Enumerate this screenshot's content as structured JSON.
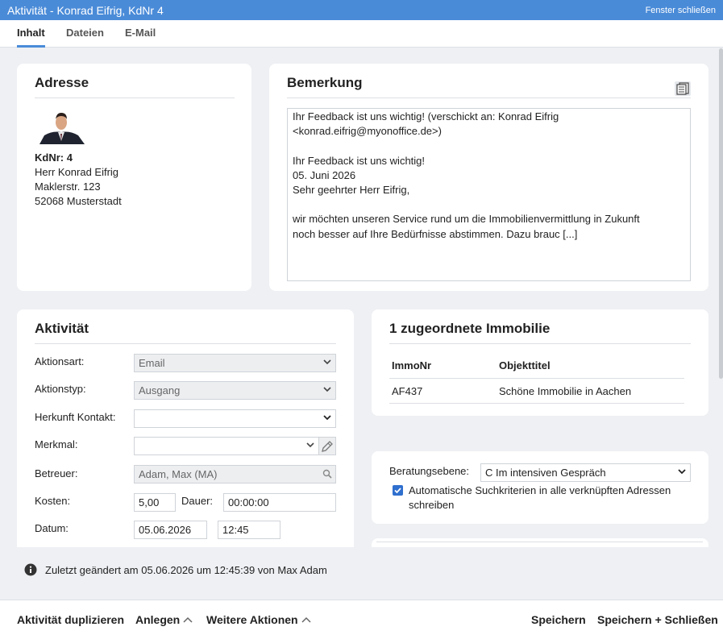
{
  "window": {
    "title": "Aktivität - Konrad Eifrig, KdNr 4",
    "close_label": "Fenster schließen"
  },
  "tabs": [
    {
      "label": "Inhalt"
    },
    {
      "label": "Dateien"
    },
    {
      "label": "E-Mail"
    }
  ],
  "address": {
    "heading": "Adresse",
    "kdnr": "KdNr: 4",
    "name": "Herr Konrad Eifrig",
    "street": "Maklerstr. 123",
    "city": "52068 Musterstadt"
  },
  "remark": {
    "heading": "Bemerkung",
    "icon": "notes-icon",
    "lines": [
      "Ihr Feedback ist uns wichtig! (verschickt an: Konrad Eifrig",
      "<konrad.eifrig@myonoffice.de>)",
      "",
      "Ihr Feedback ist uns wichtig!",
      "05. Juni 2026",
      "Sehr geehrter Herr Eifrig,",
      "",
      "wir möchten unseren Service rund um die Immobilienvermittlung in Zukunft",
      "noch besser auf Ihre Bedürfnisse abstimmen. Dazu brauc [...]"
    ]
  },
  "activity": {
    "heading": "Aktivität",
    "aktionsart_label": "Aktionsart:",
    "aktionsart_value": "Email",
    "aktionstyp_label": "Aktionstyp:",
    "aktionstyp_value": "Ausgang",
    "herkunft_label": "Herkunft Kontakt:",
    "herkunft_value": "",
    "merkmal_label": "Merkmal:",
    "merkmal_value": "",
    "betreuer_label": "Betreuer:",
    "betreuer_value": "Adam, Max (MA)",
    "kosten_label": "Kosten:",
    "kosten_value": "5,00",
    "dauer_label": "Dauer:",
    "dauer_value": "00:00:00",
    "datum_label": "Datum:",
    "datum_value": "05.06.2026",
    "zeit_value": "12:45"
  },
  "properties": {
    "heading": "1 zugeordnete Immobilie",
    "columns": [
      "ImmoNr",
      "Objekttitel"
    ],
    "rows": [
      {
        "immonr": "AF437",
        "titel": "Schöne Immobilie in Aachen"
      }
    ]
  },
  "advice": {
    "label": "Beratungsebene:",
    "value": "C Im intensiven Gespräch",
    "checkbox_checked": true,
    "checkbox_line1": "Automatische Suchkriterien in alle verknüpften Adressen",
    "checkbox_line2": "schreiben"
  },
  "status": {
    "text": "Zuletzt geändert am 05.06.2026 um 12:45:39 von Max Adam",
    "icon": "info-icon"
  },
  "footer": {
    "duplicate": "Aktivität duplizieren",
    "create": "Anlegen",
    "more": "Weitere Aktionen",
    "save": "Speichern",
    "save_close": "Speichern + Schließen"
  },
  "colors": {
    "accent": "#4a8bd8",
    "background": "#eef0f3",
    "checkbox": "#2f6fce"
  }
}
